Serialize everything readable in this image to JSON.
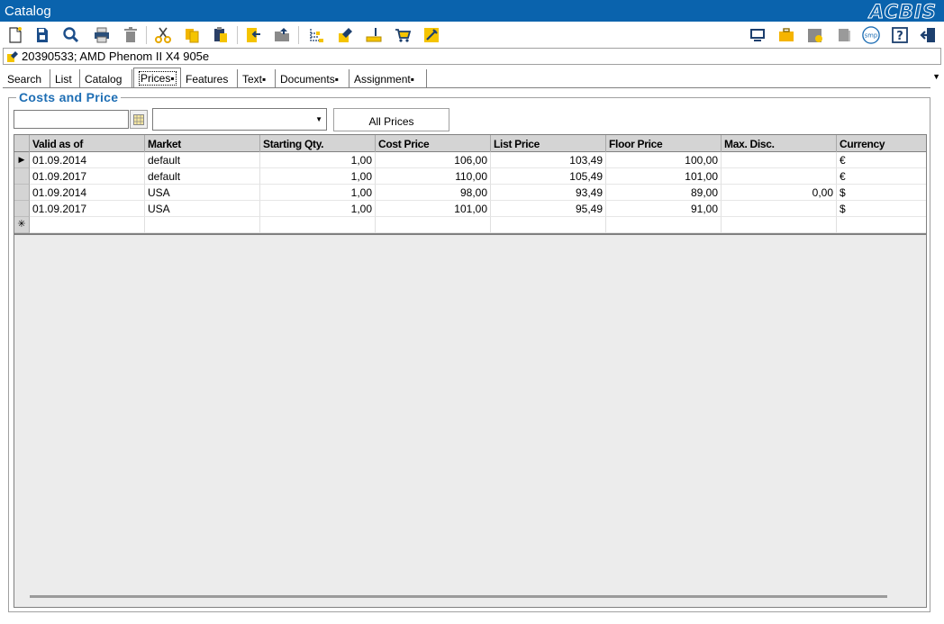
{
  "window": {
    "title": "Catalog",
    "brand": "ACBIS"
  },
  "toolbar_left": [
    {
      "name": "new-document-icon"
    },
    {
      "name": "save-icon"
    },
    {
      "name": "search-icon"
    },
    {
      "name": "print-icon"
    },
    {
      "name": "delete-icon"
    },
    {
      "name": "cut-icon"
    },
    {
      "name": "copy-icon"
    },
    {
      "name": "paste-icon"
    },
    {
      "name": "import-icon"
    },
    {
      "name": "open-folder-icon"
    },
    {
      "name": "tree-structure-icon"
    },
    {
      "name": "article-label-icon"
    },
    {
      "name": "measure-icon"
    },
    {
      "name": "shopping-cart-icon"
    },
    {
      "name": "tools-icon"
    }
  ],
  "toolbar_right": [
    {
      "name": "monitor-icon"
    },
    {
      "name": "briefcase-icon"
    },
    {
      "name": "folder-approve-icon"
    },
    {
      "name": "archive-icon"
    },
    {
      "name": "smp-icon",
      "label": "smp"
    },
    {
      "name": "help-icon",
      "label": "?"
    },
    {
      "name": "exit-icon"
    }
  ],
  "record": {
    "label": "20390533; AMD Phenom II X4 905e"
  },
  "tabs": [
    {
      "label": "Search"
    },
    {
      "label": "List"
    },
    {
      "label": "Catalog"
    },
    {
      "label": "Prices▪",
      "active": true
    },
    {
      "label": "Features"
    },
    {
      "label": "Text▪"
    },
    {
      "label": "Documents▪"
    },
    {
      "label": "Assignment▪"
    }
  ],
  "group": {
    "title": "Costs and Price"
  },
  "filters": {
    "date_value": "",
    "market_value": "",
    "all_prices_label": "All Prices"
  },
  "grid": {
    "columns": [
      "Valid as of",
      "Market",
      "Starting Qty.",
      "Cost Price",
      "List Price",
      "Floor Price",
      "Max. Disc.",
      "Currency"
    ],
    "rows": [
      [
        "01.09.2014",
        "default",
        "1,00",
        "106,00",
        "103,49",
        "100,00",
        "",
        "€"
      ],
      [
        "01.09.2017",
        "default",
        "1,00",
        "110,00",
        "105,49",
        "101,00",
        "",
        "€"
      ],
      [
        "01.09.2014",
        "USA",
        "1,00",
        "98,00",
        "93,49",
        "89,00",
        "0,00",
        "$"
      ],
      [
        "01.09.2017",
        "USA",
        "1,00",
        "101,00",
        "95,49",
        "91,00",
        "",
        "$"
      ]
    ],
    "current_row_marker": "▶",
    "new_row_marker": "✳"
  }
}
